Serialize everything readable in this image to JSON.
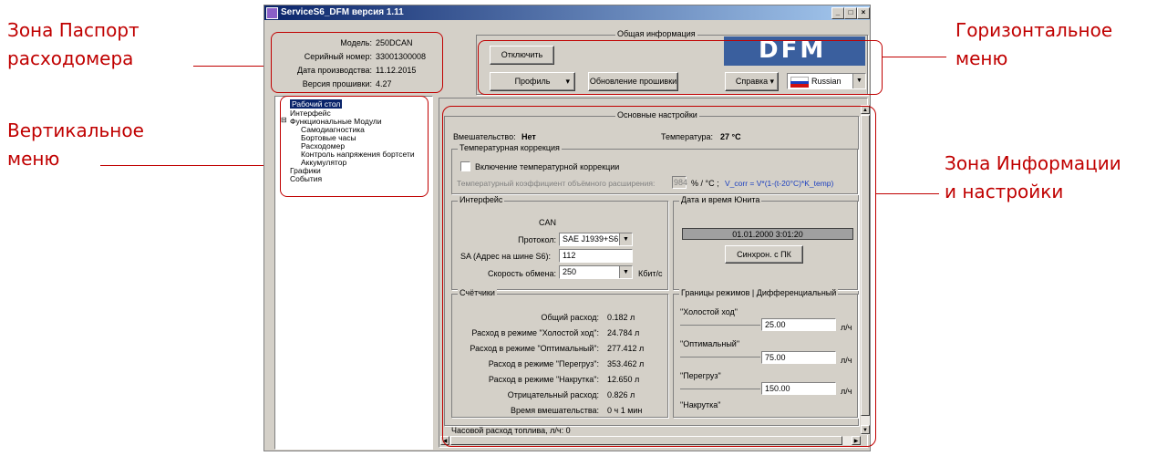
{
  "annotations": {
    "passport": [
      "Зона Паспорт",
      "расходомера"
    ],
    "vertical_menu": [
      "Вертикальное",
      "меню"
    ],
    "horizontal_menu": [
      "Горизонтальное",
      "меню"
    ],
    "info_zone": [
      "Зона Информации",
      "и настройки"
    ]
  },
  "window": {
    "title": "ServiceS6_DFM версия 1.11",
    "min": "_",
    "max": "□",
    "close": "×"
  },
  "passport": {
    "model_label": "Модель:",
    "model": "250DCAN",
    "serial_label": "Серийный номер:",
    "serial": "33001300008",
    "date_label": "Дата производства:",
    "date": "11.12.2015",
    "fw_label": "Версия прошивки:",
    "fw": "4.27"
  },
  "toolbar": {
    "group_title": "Общая информация",
    "disconnect": "Отключить",
    "profile": "Профиль",
    "fw_update": "Обновление прошивки",
    "help": "Справка",
    "language": "Russian",
    "logo": "DFM"
  },
  "tree": {
    "items": [
      "Рабочий стол",
      "Интерфейс",
      "Функциональные Модули",
      "Самодиагностика",
      "Бортовые часы",
      "Расходомер",
      "Контроль напряжения бортсети",
      "Аккумулятор",
      "Графики",
      "События"
    ]
  },
  "main": {
    "title": "Основные настройки",
    "interference_label": "Вмешательство:",
    "interference": "Нет",
    "temp_label": "Температура:",
    "temp": "27 °С",
    "tempcorr": {
      "title": "Температурная коррекция",
      "checkbox": "Включение температурной коррекции",
      "coef_label": "Температурный коэффициент объёмного расширения:",
      "coef_value": "984",
      "unit": "% / °С ;",
      "formula": "V_corr = V*(1-(t-20°C)*K_temp)"
    },
    "iface": {
      "title": "Интерфейс",
      "can": "CAN",
      "protocol_label": "Протокол:",
      "protocol": "SAE J1939+S6",
      "sa_label": "SA (Адрес на шине S6):",
      "sa": "112",
      "speed_label": "Скорость обмена:",
      "speed": "250",
      "speed_unit": "Кбит/с"
    },
    "datetime": {
      "title": "Дата и время Юнита",
      "value": "01.01.2000 3:01:20",
      "sync": "Синхрон. с ПК"
    },
    "counters": {
      "title": "Счётчики",
      "rows": [
        {
          "label": "Общий расход:",
          "value": "0.182 л"
        },
        {
          "label": "Расход в режиме \"Холостой ход\":",
          "value": "24.784 л"
        },
        {
          "label": "Расход в режиме \"Оптимальный\":",
          "value": "277.412 л"
        },
        {
          "label": "Расход в режиме \"Перегруз\":",
          "value": "353.462 л"
        },
        {
          "label": "Расход в режиме \"Накрутка\":",
          "value": "12.650 л"
        },
        {
          "label": "Отрицательный расход:",
          "value": "0.826 л"
        },
        {
          "label": "Время вмешательства:",
          "value": "0 ч 1 мин"
        }
      ]
    },
    "modes": {
      "title": "Границы режимов | Дифференциальный",
      "idle": "\"Холостой ход\"",
      "idle_val": "25.00",
      "optimal": "\"Оптимальный\"",
      "optimal_val": "75.00",
      "overload": "\"Перегруз\"",
      "overload_val": "150.00",
      "spin": "\"Накрутка\"",
      "unit": "л/ч"
    },
    "hourly": "Часовой расход топлива, л/ч: 0"
  }
}
